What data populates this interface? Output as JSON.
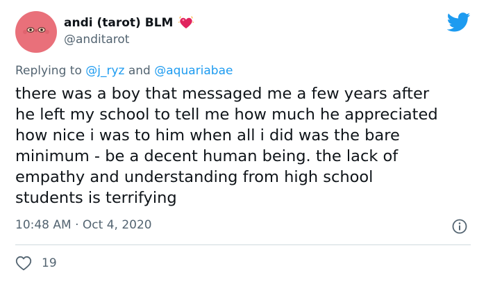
{
  "author": {
    "display_name": "andi (tarot) BLM",
    "handle": "@anditarot",
    "badge_icon": "sparkling-heart-icon",
    "avatar_color": "#e9707a"
  },
  "reply_context": {
    "prefix": "Replying to",
    "mention_1": "@j_ryz",
    "conjunction": "and",
    "mention_2": "@aquariabae"
  },
  "tweet": {
    "lines": [
      "there was a boy that messaged me a few years after",
      "he left my school to tell me how much he appreciated",
      "how nice i was to him when all i did was the bare",
      "minimum - be a decent human being. the lack of",
      "empathy and understanding from high school",
      "students is terrifying"
    ]
  },
  "meta": {
    "time": "10:48 AM",
    "separator": "·",
    "date": "Oct 4, 2020"
  },
  "engagement": {
    "likes": "19"
  },
  "colors": {
    "brand_blue": "#1d9bf0",
    "secondary_text": "#536471",
    "primary_text": "#0f1419",
    "heart_red": "#e0245e"
  },
  "icons": {
    "logo": "twitter-bird-icon",
    "info": "info-icon",
    "like": "heart-outline-icon"
  }
}
